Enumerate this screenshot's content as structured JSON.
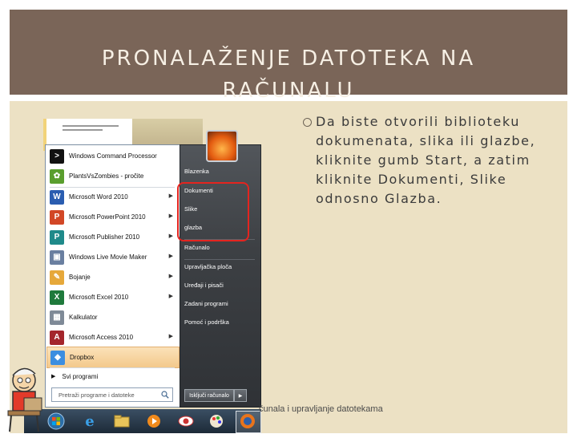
{
  "slide": {
    "title_line1": "PRONALAŽENJE DATOTEKA NA",
    "title_line2": "RAČUNALU",
    "bullet": "Da biste otvorili biblioteku dokumenata, slika ili glazbe, kliknite gumb Start, a zatim kliknite Dokumenti, Slike odnosno Glazba.",
    "footer": "čunala i upravljanje datotekama",
    "colors": {
      "title_bg": "#7a6558",
      "body_bg": "#ece1c4",
      "highlight_border": "#e4241f"
    }
  },
  "start_menu": {
    "programs": [
      {
        "label": "Windows Command Processor",
        "icon": "cmd-icon",
        "arrow": false
      },
      {
        "label": "PlantsVsZombies - pročite",
        "icon": "plants-vs-zombies-icon",
        "arrow": false
      },
      {
        "label": "Microsoft Word 2010",
        "icon": "word-icon",
        "arrow": true
      },
      {
        "label": "Microsoft PowerPoint 2010",
        "icon": "powerpoint-icon",
        "arrow": true
      },
      {
        "label": "Microsoft Publisher 2010",
        "icon": "publisher-icon",
        "arrow": true
      },
      {
        "label": "Windows Live Movie Maker",
        "icon": "movie-maker-icon",
        "arrow": true
      },
      {
        "label": "Bojanje",
        "icon": "paint-icon",
        "arrow": true
      },
      {
        "label": "Microsoft Excel 2010",
        "icon": "excel-icon",
        "arrow": true
      },
      {
        "label": "Kalkulator",
        "icon": "calculator-icon",
        "arrow": false
      },
      {
        "label": "Microsoft Access 2010",
        "icon": "access-icon",
        "arrow": true
      },
      {
        "label": "Dropbox",
        "icon": "dropbox-icon",
        "arrow": false
      }
    ],
    "all_programs": "Svi programi",
    "search_placeholder": "Pretraži programe i datoteke",
    "right_items": [
      {
        "label": "Blazenka"
      },
      {
        "label": "Dokumenti"
      },
      {
        "label": "Slike"
      },
      {
        "label": "glazba"
      },
      {
        "label": "Računalo"
      },
      {
        "label": "Upravljačka ploča"
      },
      {
        "label": "Uređaji i pisači"
      },
      {
        "label": "Zadani programi"
      },
      {
        "label": "Pomoć i podrška"
      }
    ],
    "shutdown": "Isključi računalo"
  }
}
